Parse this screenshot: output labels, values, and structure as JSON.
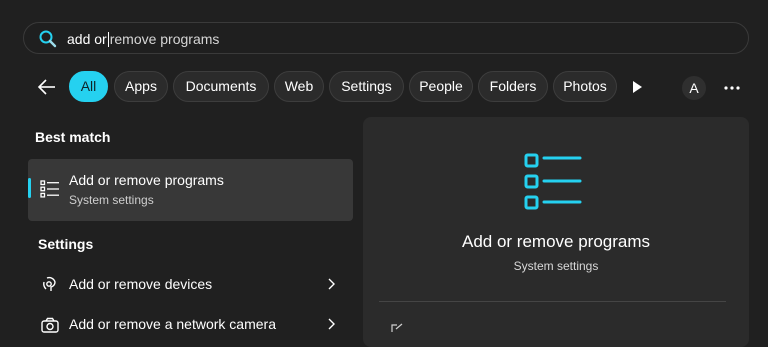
{
  "search": {
    "typed": "add or",
    "suggestion": "remove programs"
  },
  "filters": [
    "All",
    "Apps",
    "Documents",
    "Web",
    "Settings",
    "People",
    "Folders",
    "Photos"
  ],
  "avatar_initial": "A",
  "best_match": {
    "heading": "Best match",
    "title": "Add or remove programs",
    "subtitle": "System settings"
  },
  "settings": {
    "heading": "Settings",
    "items": [
      {
        "label": "Add or remove devices",
        "icon": "bluetooth-devices-icon"
      },
      {
        "label": "Add or remove a network camera",
        "icon": "camera-icon"
      }
    ]
  },
  "preview": {
    "title": "Add or remove programs",
    "subtitle": "System settings",
    "icon": "app-list-icon"
  },
  "colors": {
    "accent": "#25d1f0",
    "background": "#202020",
    "panel": "#2b2b2b",
    "selected": "#383838"
  }
}
